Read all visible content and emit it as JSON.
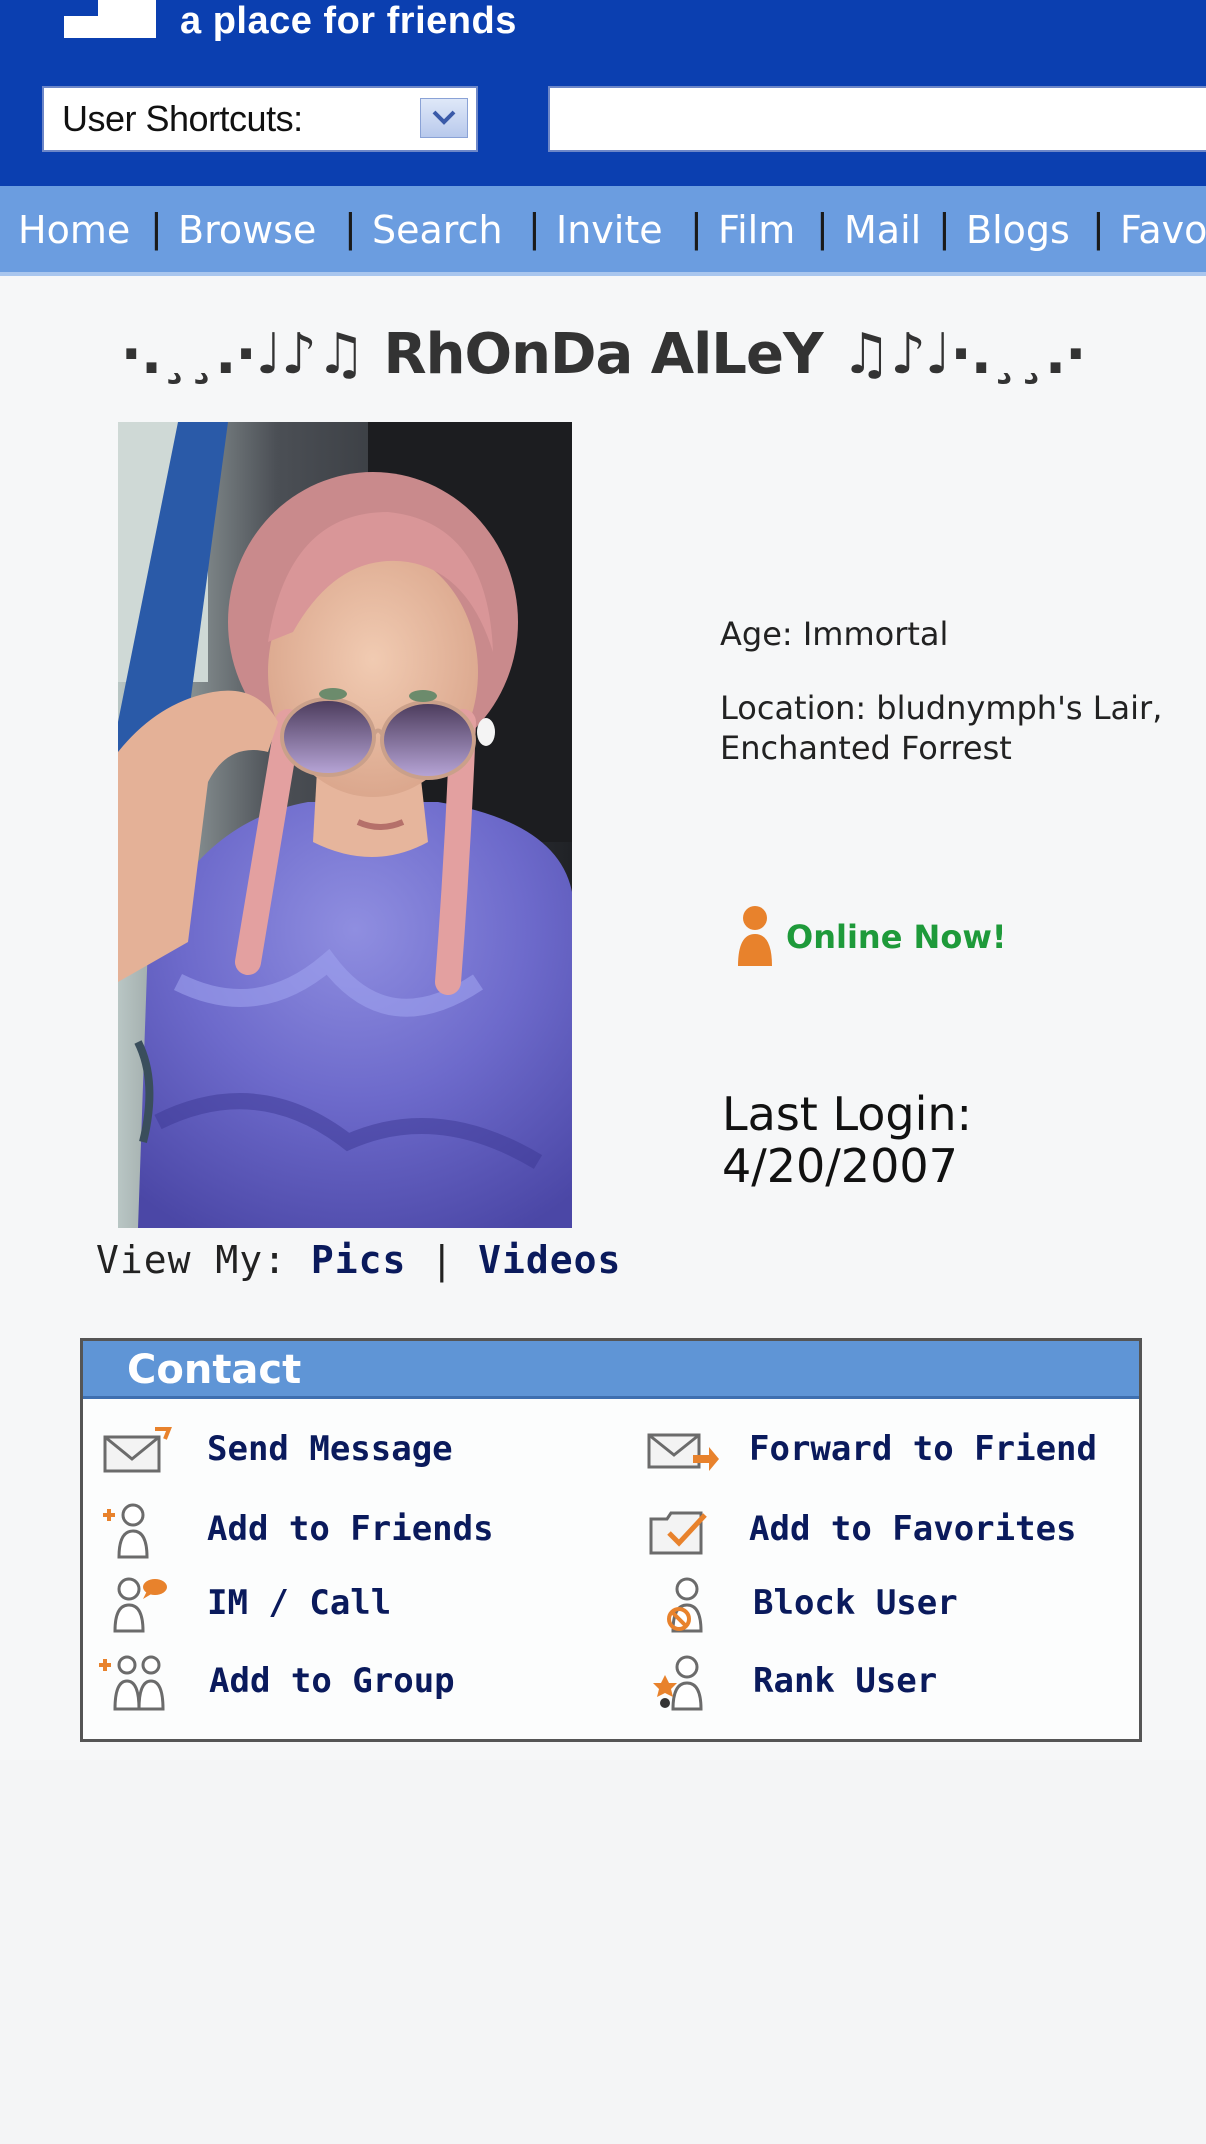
{
  "header": {
    "tagline": "a place for friends",
    "shortcuts_label": "User Shortcuts:",
    "search_value": ""
  },
  "nav": {
    "items": [
      "Home",
      "Browse",
      "Search",
      "Invite",
      "Film",
      "Mail",
      "Blogs",
      "Favo"
    ]
  },
  "profile": {
    "name": "·.¸¸.·♩♪♫ RhOnDa AlLeY ♫♪♩·.¸¸.·",
    "age": "Age: Immortal",
    "location_line1": "Location: bludnymph's Lair,",
    "location_line2": "Enchanted Forrest",
    "online_status": "Online Now!",
    "last_login_label": "Last Login:",
    "last_login_date": "4/20/2007",
    "view_my_label": "View My:",
    "view_pics": "Pics",
    "view_sep": "|",
    "view_videos": "Videos"
  },
  "contact": {
    "title": "Contact",
    "actions": [
      {
        "label": "Send Message",
        "icon": "envelope-icon"
      },
      {
        "label": "Forward to Friend",
        "icon": "forward-envelope-icon"
      },
      {
        "label": "Add to Friends",
        "icon": "add-friend-icon"
      },
      {
        "label": "Add to Favorites",
        "icon": "folder-check-icon"
      },
      {
        "label": "IM / Call",
        "icon": "chat-user-icon"
      },
      {
        "label": "Block User",
        "icon": "block-user-icon"
      },
      {
        "label": "Add to Group",
        "icon": "add-group-icon"
      },
      {
        "label": "Rank User",
        "icon": "rank-user-icon"
      }
    ]
  },
  "colors": {
    "header_blue": "#0b3fb0",
    "nav_blue": "#6b9de0",
    "online_green": "#1e9a3a",
    "icon_orange": "#e8822c",
    "link_navy": "#0a1a5c"
  }
}
